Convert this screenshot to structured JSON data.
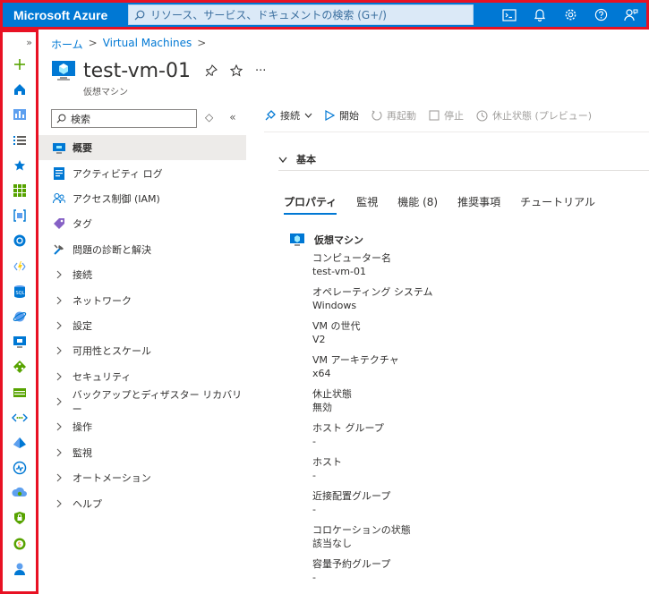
{
  "topbar": {
    "brand": "Microsoft Azure",
    "search_placeholder": "リソース、サービス、ドキュメントの検索 (G+/)",
    "icons": [
      "cloud-shell-icon",
      "bell-icon",
      "gear-icon",
      "help-icon",
      "feedback-icon"
    ]
  },
  "rail": {
    "expand_label": "»",
    "icons": [
      "plus-icon",
      "home-icon",
      "dashboard-icon",
      "list-icon",
      "star-icon",
      "grid-icon",
      "resource-group-icon",
      "cube-icon",
      "function-icon",
      "sql-icon",
      "cosmos-icon",
      "vm-icon",
      "load-balancer-icon",
      "storage-icon",
      "vnet-icon",
      "entra-icon",
      "monitor-icon",
      "advisor-icon",
      "defender-icon",
      "cost-icon",
      "help-support-icon"
    ]
  },
  "breadcrumb": {
    "home": "ホーム",
    "sep": ">",
    "vms": "Virtual Machines",
    "sep2": ">"
  },
  "header": {
    "title": "test-vm-01",
    "subtitle": "仮想マシン",
    "more": "···"
  },
  "nav": {
    "search_placeholder": "検索",
    "sort": "◇",
    "collapse": "«",
    "items": [
      {
        "label": "概要",
        "type": "icon",
        "icon": "vm-icon",
        "active": true
      },
      {
        "label": "アクティビティ ログ",
        "type": "icon",
        "icon": "activity-log-icon"
      },
      {
        "label": "アクセス制御 (IAM)",
        "type": "icon",
        "icon": "iam-icon"
      },
      {
        "label": "タグ",
        "type": "icon",
        "icon": "tag-icon"
      },
      {
        "label": "問題の診断と解決",
        "type": "icon",
        "icon": "diagnose-icon"
      },
      {
        "label": "接続",
        "type": "group"
      },
      {
        "label": "ネットワーク",
        "type": "group"
      },
      {
        "label": "設定",
        "type": "group"
      },
      {
        "label": "可用性とスケール",
        "type": "group"
      },
      {
        "label": "セキュリティ",
        "type": "group"
      },
      {
        "label": "バックアップとディザスター リカバリー",
        "type": "group"
      },
      {
        "label": "操作",
        "type": "group"
      },
      {
        "label": "監視",
        "type": "group"
      },
      {
        "label": "オートメーション",
        "type": "group"
      },
      {
        "label": "ヘルプ",
        "type": "group"
      }
    ]
  },
  "toolbar": {
    "connect": "接続",
    "start": "開始",
    "restart": "再起動",
    "stop": "停止",
    "hibernate": "休止状態 (プレビュー)"
  },
  "section": {
    "label": "基本"
  },
  "tabs": [
    {
      "label": "プロパティ",
      "active": true
    },
    {
      "label": "監視"
    },
    {
      "label": "機能 (8)"
    },
    {
      "label": "推奨事項"
    },
    {
      "label": "チュートリアル"
    }
  ],
  "properties": {
    "heading": "仮想マシン",
    "items": [
      {
        "label": "コンピューター名",
        "value": "test-vm-01"
      },
      {
        "label": "オペレーティング システム",
        "value": "Windows"
      },
      {
        "label": "VM の世代",
        "value": "V2"
      },
      {
        "label": "VM アーキテクチャ",
        "value": "x64"
      },
      {
        "label": "休止状態",
        "value": "無効"
      },
      {
        "label": "ホスト グループ",
        "value": "-"
      },
      {
        "label": "ホスト",
        "value": "-"
      },
      {
        "label": "近接配置グループ",
        "value": "-"
      },
      {
        "label": "コロケーションの状態",
        "value": "該当なし"
      },
      {
        "label": "容量予約グループ",
        "value": "-"
      }
    ]
  },
  "colors": {
    "azure_blue": "#0078d4",
    "highlight_red": "#e81123"
  }
}
